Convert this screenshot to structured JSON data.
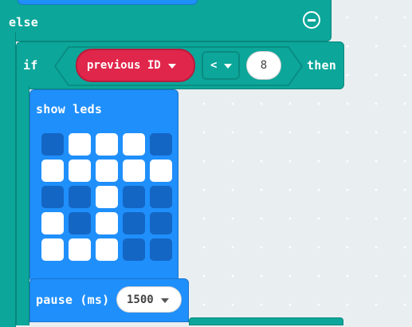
{
  "else_block": {
    "keyword": "else"
  },
  "if_block": {
    "if_keyword": "if",
    "then_keyword": "then",
    "variable": "previous ID",
    "operator": "<",
    "value": "8"
  },
  "show_leds": {
    "label": "show leds",
    "grid": [
      [
        0,
        1,
        1,
        1,
        0
      ],
      [
        1,
        1,
        1,
        1,
        1
      ],
      [
        0,
        0,
        1,
        0,
        0
      ],
      [
        1,
        0,
        1,
        0,
        0
      ],
      [
        1,
        1,
        1,
        0,
        0
      ]
    ]
  },
  "pause": {
    "label": "pause (ms)",
    "value": "1500"
  },
  "colors": {
    "logic": "#0ca69a",
    "basic": "#1f8ffb",
    "variable": "#e1264b",
    "workspace": "#e9eef0"
  }
}
